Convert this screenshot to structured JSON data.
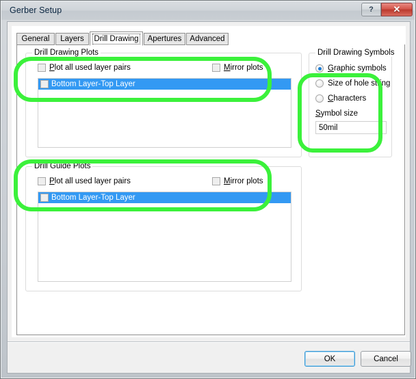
{
  "window": {
    "title": "Gerber Setup",
    "buttons": {
      "help": "?",
      "close": "✕"
    }
  },
  "tabs": [
    {
      "label": "General",
      "active": false
    },
    {
      "label": "Layers",
      "active": false
    },
    {
      "label": "Drill Drawing",
      "active": true
    },
    {
      "label": "Apertures",
      "active": false
    },
    {
      "label": "Advanced",
      "active": false
    }
  ],
  "drill_drawing_plots": {
    "group_label": "Drill Drawing Plots",
    "plot_all_label_pre": "P",
    "plot_all_label_post": "lot all used layer pairs",
    "plot_all_checked": false,
    "mirror_label_pre": "M",
    "mirror_label_post": "irror plots",
    "mirror_checked": false,
    "list_items": [
      {
        "label": "Bottom Layer-Top Layer",
        "checked": false,
        "selected": true
      }
    ]
  },
  "drill_guide_plots": {
    "group_label": "Drill Guide Plots",
    "plot_all_label_pre": "P",
    "plot_all_label_post": "lot all used layer pairs",
    "plot_all_checked": false,
    "mirror_label_pre": "M",
    "mirror_label_post": "irror plots",
    "mirror_checked": false,
    "list_items": [
      {
        "label": "Bottom Layer-Top Layer",
        "checked": false,
        "selected": true
      }
    ]
  },
  "drill_drawing_symbols": {
    "group_label": "Drill Drawing Symbols",
    "options": [
      {
        "pre": "G",
        "post": "raphic symbols",
        "selected": true
      },
      {
        "pre": "Si",
        "post": "ze of hole string",
        "selected": false
      },
      {
        "pre": "C",
        "post": "haracters",
        "selected": false
      }
    ],
    "symbol_size_label_pre": "S",
    "symbol_size_label_post": "ymbol size",
    "symbol_size_value": "50mil"
  },
  "footer": {
    "ok_label": "OK",
    "cancel_label": "Cancel"
  },
  "annotation": {
    "color": "#3bf13b",
    "count": 3
  }
}
